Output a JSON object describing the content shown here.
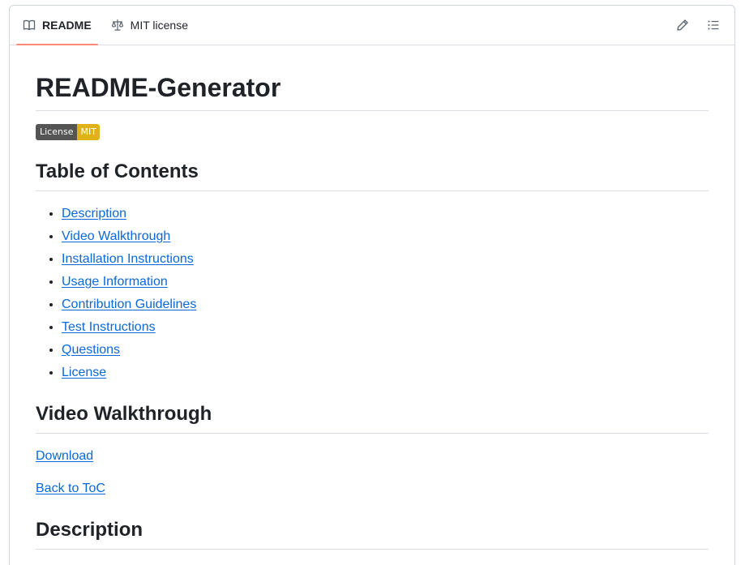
{
  "tabs": [
    {
      "label": "README",
      "icon": "book-icon",
      "active": true
    },
    {
      "label": "MIT license",
      "icon": "law-scale-icon",
      "active": false
    }
  ],
  "actions": [
    {
      "icon": "pencil-icon"
    },
    {
      "icon": "list-unordered-icon"
    }
  ],
  "readme": {
    "title": "README-Generator",
    "badge": {
      "label": "License",
      "value": "MIT",
      "label_color": "#555555",
      "value_color": "#dfb317"
    },
    "toc_heading": "Table of Contents",
    "toc": [
      "Description",
      "Video Walkthrough",
      "Installation Instructions",
      "Usage Information",
      "Contribution Guidelines",
      "Test Instructions",
      "Questions",
      "License"
    ],
    "video_heading": "Video Walkthrough",
    "download_link": "Download",
    "back_link": "Back to ToC",
    "description_heading": "Description"
  },
  "colors": {
    "link": "#0969da",
    "active_tab_underline": "#fd8c73",
    "border": "#d0d7de"
  }
}
